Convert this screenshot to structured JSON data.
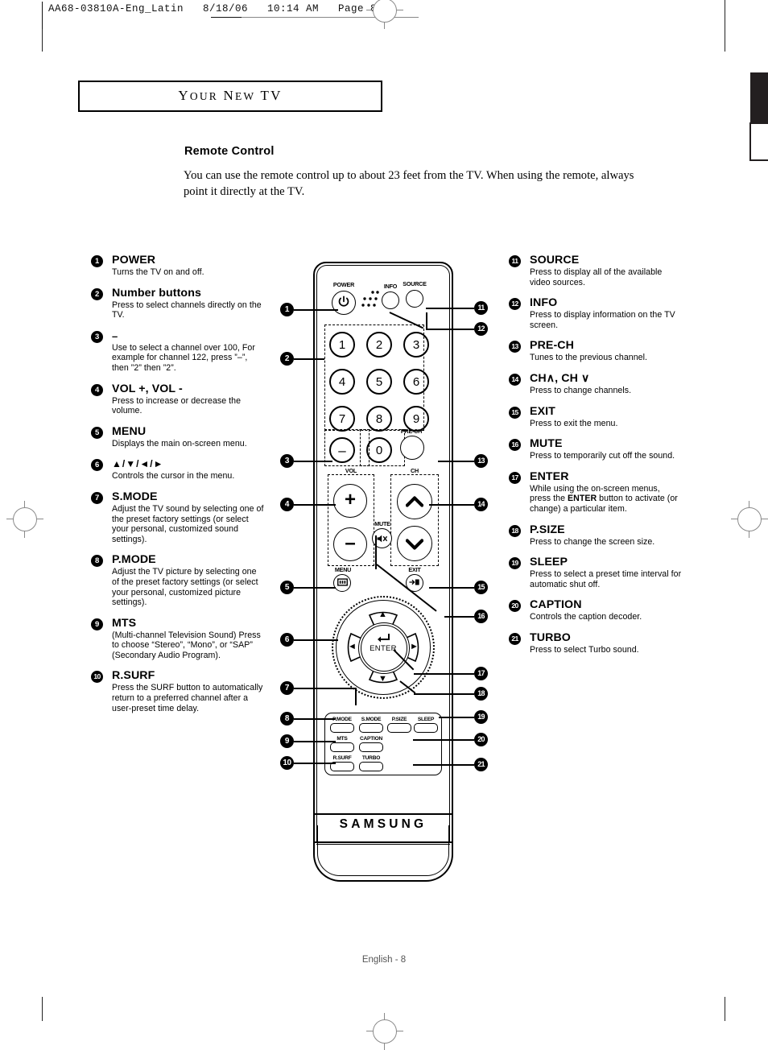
{
  "print_header": {
    "text": "AA68-03810A-Eng_Latin   8/18/06   10:14 AM   Page 8"
  },
  "chapter": {
    "title_first": "Y",
    "title_rest": "OUR ",
    "title_second": "N",
    "title_second_rest": "EW ",
    "title_third": "TV",
    "full": "YOUR NEW TV"
  },
  "section": {
    "heading": "Remote Control",
    "intro": "You can use the remote control up to about 23 feet from the TV. When using the remote, always point it directly at the TV."
  },
  "left_items": [
    {
      "num": "1",
      "title": "POWER",
      "desc": "Turns the TV on and off."
    },
    {
      "num": "2",
      "title": "Number buttons",
      "desc": "Press to select channels directly on the TV."
    },
    {
      "num": "3",
      "title": "–",
      "desc": "Use to select a channel over 100, For example for channel 122, press ”–”, then ”2” then ”2”."
    },
    {
      "num": "4",
      "title": "VOL +, VOL -",
      "desc": "Press to increase or decrease the volume."
    },
    {
      "num": "5",
      "title": "MENU",
      "desc": "Displays the main on-screen menu."
    },
    {
      "num": "6",
      "title": "▲/▼/◄/►",
      "desc": "Controls the cursor in the menu."
    },
    {
      "num": "7",
      "title": "S.MODE",
      "desc": "Adjust the TV sound by selecting one of the preset factory settings (or select your personal, customized sound settings)."
    },
    {
      "num": "8",
      "title": "P.MODE",
      "desc": "Adjust the TV picture by selecting one of the preset factory settings (or select your personal, customized picture settings)."
    },
    {
      "num": "9",
      "title": "MTS",
      "desc": "(Multi-channel Television Sound) Press to choose “Stereo”, “Mono”, or “SAP” (Secondary Audio Program)."
    },
    {
      "num": "10",
      "title": "R.SURF",
      "desc": "Press the SURF button to automatically return to a preferred channel after a user-preset time delay."
    }
  ],
  "right_items": [
    {
      "num": "11",
      "title": "SOURCE",
      "desc": "Press to display all of the available video sources."
    },
    {
      "num": "12",
      "title": "INFO",
      "desc": "Press to display information on the TV screen."
    },
    {
      "num": "13",
      "title": "PRE-CH",
      "desc": "Tunes to the previous channel."
    },
    {
      "num": "14",
      "title": "CH∧, CH ∨",
      "desc": "Press to change channels."
    },
    {
      "num": "15",
      "title": "EXIT",
      "desc": "Press to exit the menu."
    },
    {
      "num": "16",
      "title": "MUTE",
      "desc": "Press to temporarily cut off the sound."
    },
    {
      "num": "17",
      "title": "ENTER",
      "desc_a": "While using the on-screen menus, press the ",
      "desc_b": "ENTER",
      "desc_c": " button to activate (or change) a particular item."
    },
    {
      "num": "18",
      "title": "P.SIZE",
      "desc": "Press to change the screen size."
    },
    {
      "num": "19",
      "title": "SLEEP",
      "desc": "Press to select a preset time interval for automatic shut off."
    },
    {
      "num": "20",
      "title": "CAPTION",
      "desc": "Controls the caption decoder."
    },
    {
      "num": "21",
      "title": "TURBO",
      "desc": "Press to select Turbo sound."
    }
  ],
  "remote": {
    "brand": "SAMSUNG",
    "power_label": "POWER",
    "power_glyph": "⏻",
    "info_label": "INFO",
    "source_label": "SOURCE",
    "prech_label": "PRE-CH",
    "vol_label": "VOL",
    "ch_label": "CH",
    "mute_label": "MUTE",
    "mute_glyph": "🔇",
    "menu_label": "MENU",
    "menu_glyph": "▥",
    "exit_label": "EXIT",
    "exit_glyph": "⇥",
    "enter_label": "ENTER",
    "enter_glyph": "↵",
    "minus_glyph": "–",
    "vol_plus_glyph": "+",
    "vol_minus_glyph": "–",
    "ch_up_glyph": "∧",
    "ch_down_glyph": "∨",
    "nav_up": "▲",
    "nav_down": "▼",
    "nav_left": "◄",
    "nav_right": "►",
    "number_keys": [
      "1",
      "2",
      "3",
      "4",
      "5",
      "6",
      "7",
      "8",
      "9",
      "0"
    ],
    "grid_buttons": [
      "P.MODE",
      "S.MODE",
      "P.SIZE",
      "SLEEP",
      "MTS",
      "CAPTION",
      "R.SURF",
      "TURBO"
    ]
  },
  "callouts_left": [
    "1",
    "2",
    "3",
    "4",
    "5",
    "6",
    "7",
    "8",
    "9",
    "10"
  ],
  "callouts_right": [
    "11",
    "12",
    "13",
    "14",
    "15",
    "16",
    "17",
    "18",
    "19",
    "20",
    "21"
  ],
  "footer": {
    "text": "English - 8"
  }
}
